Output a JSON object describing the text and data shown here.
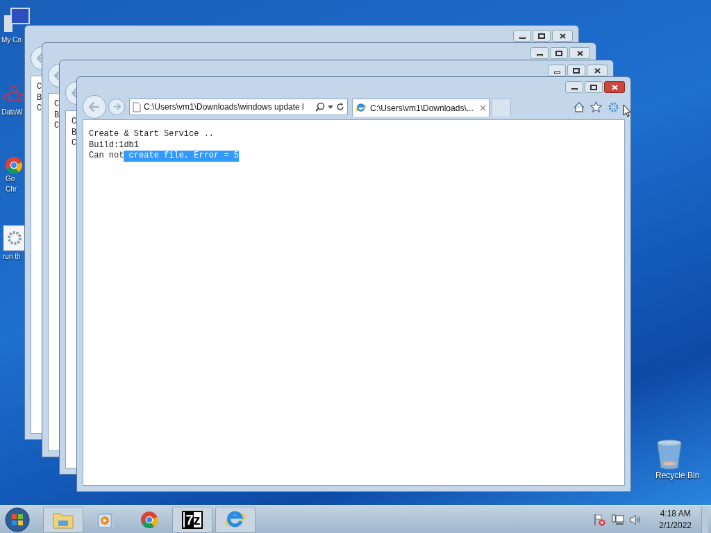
{
  "desktop_icons": [
    {
      "lines": [
        "My Co"
      ],
      "kind": "computer"
    },
    {
      "lines": [
        "DataW"
      ],
      "kind": "data"
    },
    {
      "lines": [
        "Go",
        "Chr"
      ],
      "kind": "chrome"
    },
    {
      "lines": [
        "run th"
      ],
      "kind": "gear"
    },
    {
      "lines": [
        "Recycle Bin"
      ],
      "kind": "bin"
    }
  ],
  "back_windows": [
    {
      "lines": [
        "C",
        "B",
        "C"
      ]
    },
    {
      "lines": [
        "C",
        "B",
        "C"
      ]
    },
    {
      "lines": [
        "C",
        "B",
        "C"
      ]
    }
  ],
  "browser": {
    "address": "C:\\Users\\vm1\\Downloads\\windows update l",
    "tabs": [
      {
        "label": "C:\\Users\\vm1\\Downloads\\...",
        "selected": true
      }
    ],
    "content": [
      [
        {
          "text": "Create & Start Service ..",
          "selected": false
        }
      ],
      [
        {
          "text": "Build:1db1",
          "selected": false
        }
      ],
      [
        {
          "text": "Can not",
          "selected": false
        },
        {
          "text": " create file. Error = 5",
          "selected": true
        }
      ]
    ]
  },
  "taskbar": {
    "apps": [
      {
        "kind": "explorer",
        "open": true
      },
      {
        "kind": "media",
        "open": false
      },
      {
        "kind": "chrome",
        "open": false
      },
      {
        "kind": "sevenzip",
        "open": true,
        "label": "7z"
      },
      {
        "kind": "ie",
        "open": true
      }
    ],
    "time": "4:18 AM",
    "date": "2/1/2022"
  }
}
